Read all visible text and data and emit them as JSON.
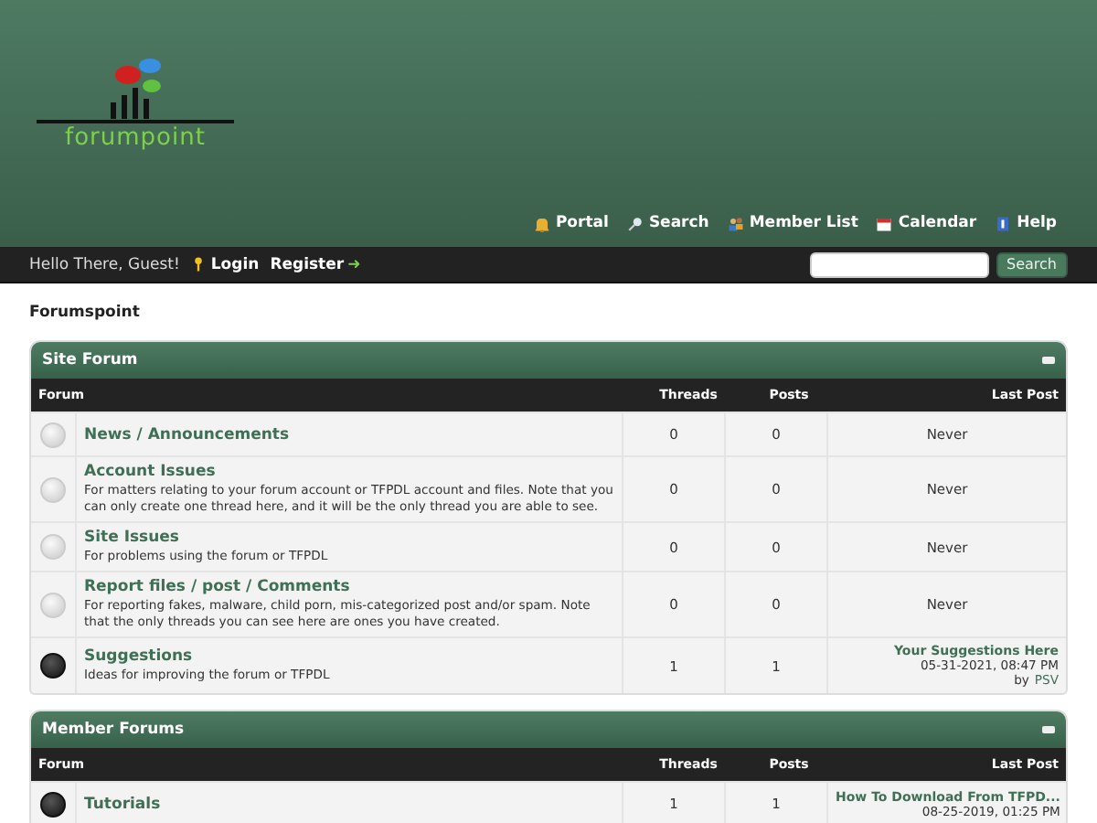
{
  "logo": {
    "text": "forumpoint"
  },
  "nav": [
    {
      "label": "Portal"
    },
    {
      "label": "Search"
    },
    {
      "label": "Member List"
    },
    {
      "label": "Calendar"
    },
    {
      "label": "Help"
    }
  ],
  "user_bar": {
    "greeting": "Hello There, Guest!",
    "login": "Login",
    "register": "Register",
    "register_arrow": "➜",
    "search_button": "Search"
  },
  "breadcrumb": "Forumspoint",
  "categories": [
    {
      "title": "Site Forum",
      "columns": [
        "Forum",
        "Threads",
        "Posts",
        "Last Post"
      ],
      "forums": [
        {
          "name": "News / Announcements",
          "new_posts": false,
          "threads": "0",
          "posts": "0",
          "last_post": {
            "never": "Never"
          }
        },
        {
          "name": "Account Issues",
          "description": "For matters relating to your forum account or TFPDL account and files. Note that you can only create one thread here, and it will be the only thread you are able to see.",
          "new_posts": false,
          "threads": "0",
          "posts": "0",
          "last_post": {
            "never": "Never"
          }
        },
        {
          "name": "Site Issues",
          "description": "For problems using the forum or TFPDL",
          "new_posts": false,
          "threads": "0",
          "posts": "0",
          "last_post": {
            "never": "Never"
          }
        },
        {
          "name": "Report files / post / Comments",
          "description": "For reporting fakes, malware, child porn, mis-categorized post and/or spam. Note that the only threads you can see here are ones you have created.",
          "new_posts": false,
          "threads": "0",
          "posts": "0",
          "last_post": {
            "never": "Never"
          }
        },
        {
          "name": "Suggestions",
          "description": "Ideas for improving the forum or TFPDL",
          "new_posts": true,
          "threads": "1",
          "posts": "1",
          "last_post": {
            "thread": "Your Suggestions Here",
            "date": "05-31-2021, 08:47 PM",
            "by": "by",
            "user": "PSV"
          }
        }
      ]
    },
    {
      "title": "Member Forums",
      "columns": [
        "Forum",
        "Threads",
        "Posts",
        "Last Post"
      ],
      "forums": [
        {
          "name": "Tutorials",
          "new_posts": true,
          "threads": "1",
          "posts": "1",
          "last_post": {
            "thread": "How To Download From TFPD...",
            "date": "08-25-2019, 01:25 PM"
          }
        }
      ]
    }
  ]
}
